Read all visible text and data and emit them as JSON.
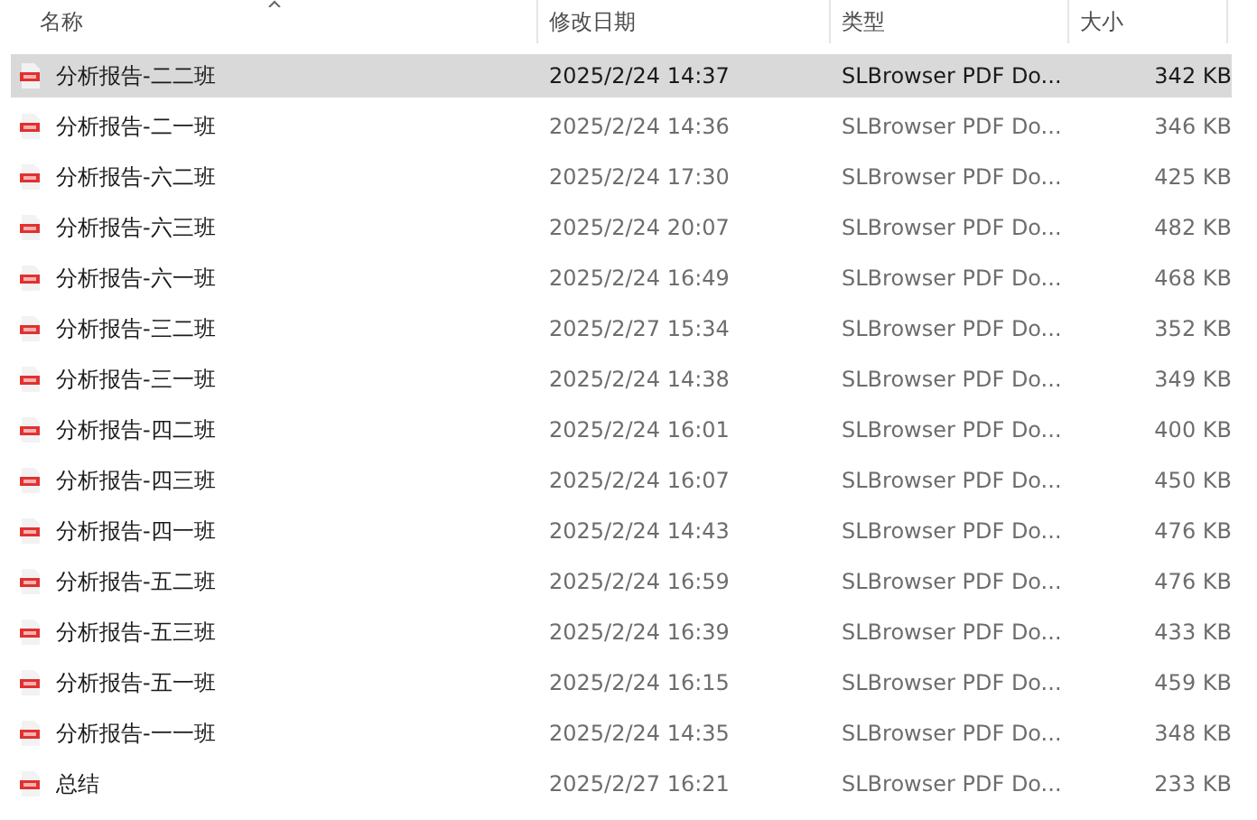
{
  "columns": [
    "名称",
    "修改日期",
    "类型",
    "大小"
  ],
  "files": [
    {
      "name": "分析报告-二二班",
      "modified": "2025/2/24 14:37",
      "type": "SLBrowser PDF Do...",
      "size": "342 KB",
      "selected": true
    },
    {
      "name": "分析报告-二一班",
      "modified": "2025/2/24 14:36",
      "type": "SLBrowser PDF Do...",
      "size": "346 KB",
      "selected": false
    },
    {
      "name": "分析报告-六二班",
      "modified": "2025/2/24 17:30",
      "type": "SLBrowser PDF Do...",
      "size": "425 KB",
      "selected": false
    },
    {
      "name": "分析报告-六三班",
      "modified": "2025/2/24 20:07",
      "type": "SLBrowser PDF Do...",
      "size": "482 KB",
      "selected": false
    },
    {
      "name": "分析报告-六一班",
      "modified": "2025/2/24 16:49",
      "type": "SLBrowser PDF Do...",
      "size": "468 KB",
      "selected": false
    },
    {
      "name": "分析报告-三二班",
      "modified": "2025/2/27 15:34",
      "type": "SLBrowser PDF Do...",
      "size": "352 KB",
      "selected": false
    },
    {
      "name": "分析报告-三一班",
      "modified": "2025/2/24 14:38",
      "type": "SLBrowser PDF Do...",
      "size": "349 KB",
      "selected": false
    },
    {
      "name": "分析报告-四二班",
      "modified": "2025/2/24 16:01",
      "type": "SLBrowser PDF Do...",
      "size": "400 KB",
      "selected": false
    },
    {
      "name": "分析报告-四三班",
      "modified": "2025/2/24 16:07",
      "type": "SLBrowser PDF Do...",
      "size": "450 KB",
      "selected": false
    },
    {
      "name": "分析报告-四一班",
      "modified": "2025/2/24 14:43",
      "type": "SLBrowser PDF Do...",
      "size": "476 KB",
      "selected": false
    },
    {
      "name": "分析报告-五二班",
      "modified": "2025/2/24 16:59",
      "type": "SLBrowser PDF Do...",
      "size": "476 KB",
      "selected": false
    },
    {
      "name": "分析报告-五三班",
      "modified": "2025/2/24 16:39",
      "type": "SLBrowser PDF Do...",
      "size": "433 KB",
      "selected": false
    },
    {
      "name": "分析报告-五一班",
      "modified": "2025/2/24 16:15",
      "type": "SLBrowser PDF Do...",
      "size": "459 KB",
      "selected": false
    },
    {
      "name": "分析报告-一一班",
      "modified": "2025/2/24 14:35",
      "type": "SLBrowser PDF Do...",
      "size": "348 KB",
      "selected": false
    },
    {
      "name": "总结",
      "modified": "2025/2/27 16:21",
      "type": "SLBrowser PDF Do...",
      "size": "233 KB",
      "selected": false
    }
  ]
}
